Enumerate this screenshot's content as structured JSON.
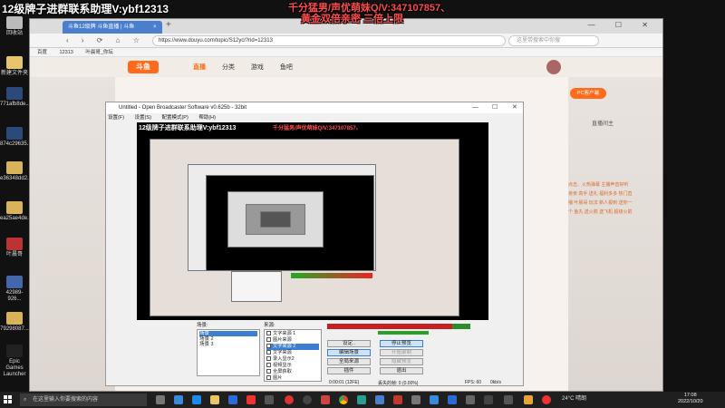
{
  "overlays": {
    "left": "12级牌子进群联系助理V:ybf12313",
    "right_line1": "千分猛男/声优萌妹Q/V:347107857、",
    "right_line2": "黄金双倍亲密 三倍上限"
  },
  "desktop_icons": [
    {
      "label": "回收站",
      "color": "#bbbbbb"
    },
    {
      "label": "新建文件夹",
      "color": "#e8c46a"
    },
    {
      "label": "771afb8de...",
      "color": "#2b4a7a"
    },
    {
      "label": "874c29635...",
      "color": "#2b4a7a"
    },
    {
      "label": "e36348dd2...",
      "color": "#d9b35a"
    },
    {
      "label": "ea25ae4de...",
      "color": "#d9b35a"
    },
    {
      "label": "叶晨哥",
      "color": "#b33"
    },
    {
      "label": "42989-926...",
      "color": "#4466aa"
    },
    {
      "label": "79298087...",
      "color": "#d9b35a"
    },
    {
      "label": "Epic Games Launcher",
      "color": "#222"
    }
  ],
  "browser": {
    "tab_title": "斗鱼12级牌 斗鱼直播 | 斗鱼",
    "tab_close": "×",
    "new_tab": "+",
    "window_controls": "—  ☐  ✕",
    "nav_buttons": "‹ › ⟳ ⌂ ☆",
    "url": "https://www.douyu.com/topic/S12ycl?rid=12313",
    "search_placeholder": "这里带搜索中你搜",
    "bookmarks": [
      "百度",
      "12313",
      "叶晨哥_你坛"
    ],
    "site": {
      "logo": "斗鱼",
      "nav": [
        "直播",
        "分类",
        "游戏",
        "鱼吧"
      ],
      "active_nav": "直播",
      "pc_button": "PC客户端",
      "room_title": "直播间主",
      "right_panel_text": "点击、火热弹幕 主播声音好听 亲亲 高手 送礼 福利多多 热门直播 叶晨哥 玩法 新人报到 送你一个 鱼丸 送火箭 送飞机 超级火箭"
    }
  },
  "obs": {
    "title": "Untitled - Open Broadcaster Software v0.625b - 32bit",
    "menu": [
      "设置(F)",
      "设置(S)",
      "配置模式(P)",
      "帮助(H)"
    ],
    "scenes_label": "场景:",
    "scenes": [
      "场景",
      "场景 2",
      "场景 3"
    ],
    "selected_scene": 0,
    "sources_label": "来源:",
    "sources": [
      "文字来源 1",
      "图片来源",
      "文字来源 2",
      "文字来源",
      "录入显示2",
      "视频显示",
      "全屏获取",
      "图片"
    ],
    "selected_source": 2,
    "buttons": {
      "settings": "设定..",
      "stop_preview": "停止预览",
      "edit_scene": "编辑场景",
      "record": "开始录制",
      "global_sources": "全局来源",
      "plugins": "插件",
      "exit": "退出",
      "hide_preview": "隐藏预览"
    },
    "status": {
      "time": "0:00:01 (12FE)",
      "dropped": "丢失的帧: 0 (0.00%)",
      "fps": "FPS: 60",
      "bitrate": "0kb/s"
    },
    "preview_overlay_left": "12级牌子进群联系助理V:ybf12313",
    "preview_overlay_right": "千分猛男/声优萌妹Q/V:347107857、"
  },
  "taskbar": {
    "search_placeholder": "在这里输入你要搜索的内容",
    "weather": "24°C 晴朗",
    "time": "17:08",
    "date": "2022/10/20"
  }
}
